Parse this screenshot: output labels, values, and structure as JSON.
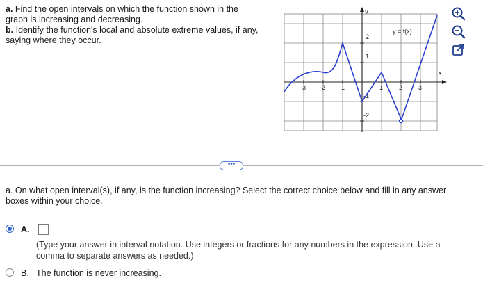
{
  "problem": {
    "a_label": "a.",
    "a_text": "Find the open intervals on which the function shown in the graph is increasing and decreasing.",
    "b_label": "b.",
    "b_text": "Identify the function's local and absolute extreme values, if any, saying where they occur."
  },
  "graph": {
    "function_label": "y = f(x)",
    "x_axis_label": "x",
    "y_axis_label": "y",
    "x_ticks": [
      "-3",
      "-2",
      "-1",
      "1",
      "2",
      "3"
    ],
    "y_ticks": [
      "2",
      "1",
      "-1",
      "-2"
    ]
  },
  "tools": [
    "zoom-in-icon",
    "zoom-out-icon",
    "popout-icon"
  ],
  "divider": {
    "more_label": "•••"
  },
  "question": {
    "label": "a.",
    "text": "On what open interval(s), if any, is the function increasing? Select the correct choice below and fill in any answer boxes within your choice."
  },
  "choices": {
    "a": {
      "letter": "A.",
      "answer_value": "",
      "hint": "(Type your answer in interval notation. Use integers or fractions for any numbers in the expression. Use a comma to separate answers as needed.)",
      "selected": true
    },
    "b": {
      "letter": "B.",
      "text": "The function is never increasing.",
      "selected": false
    }
  },
  "colors": {
    "curve": "#2b3fcf",
    "accent": "#2f62c9",
    "grid": "#888888"
  }
}
